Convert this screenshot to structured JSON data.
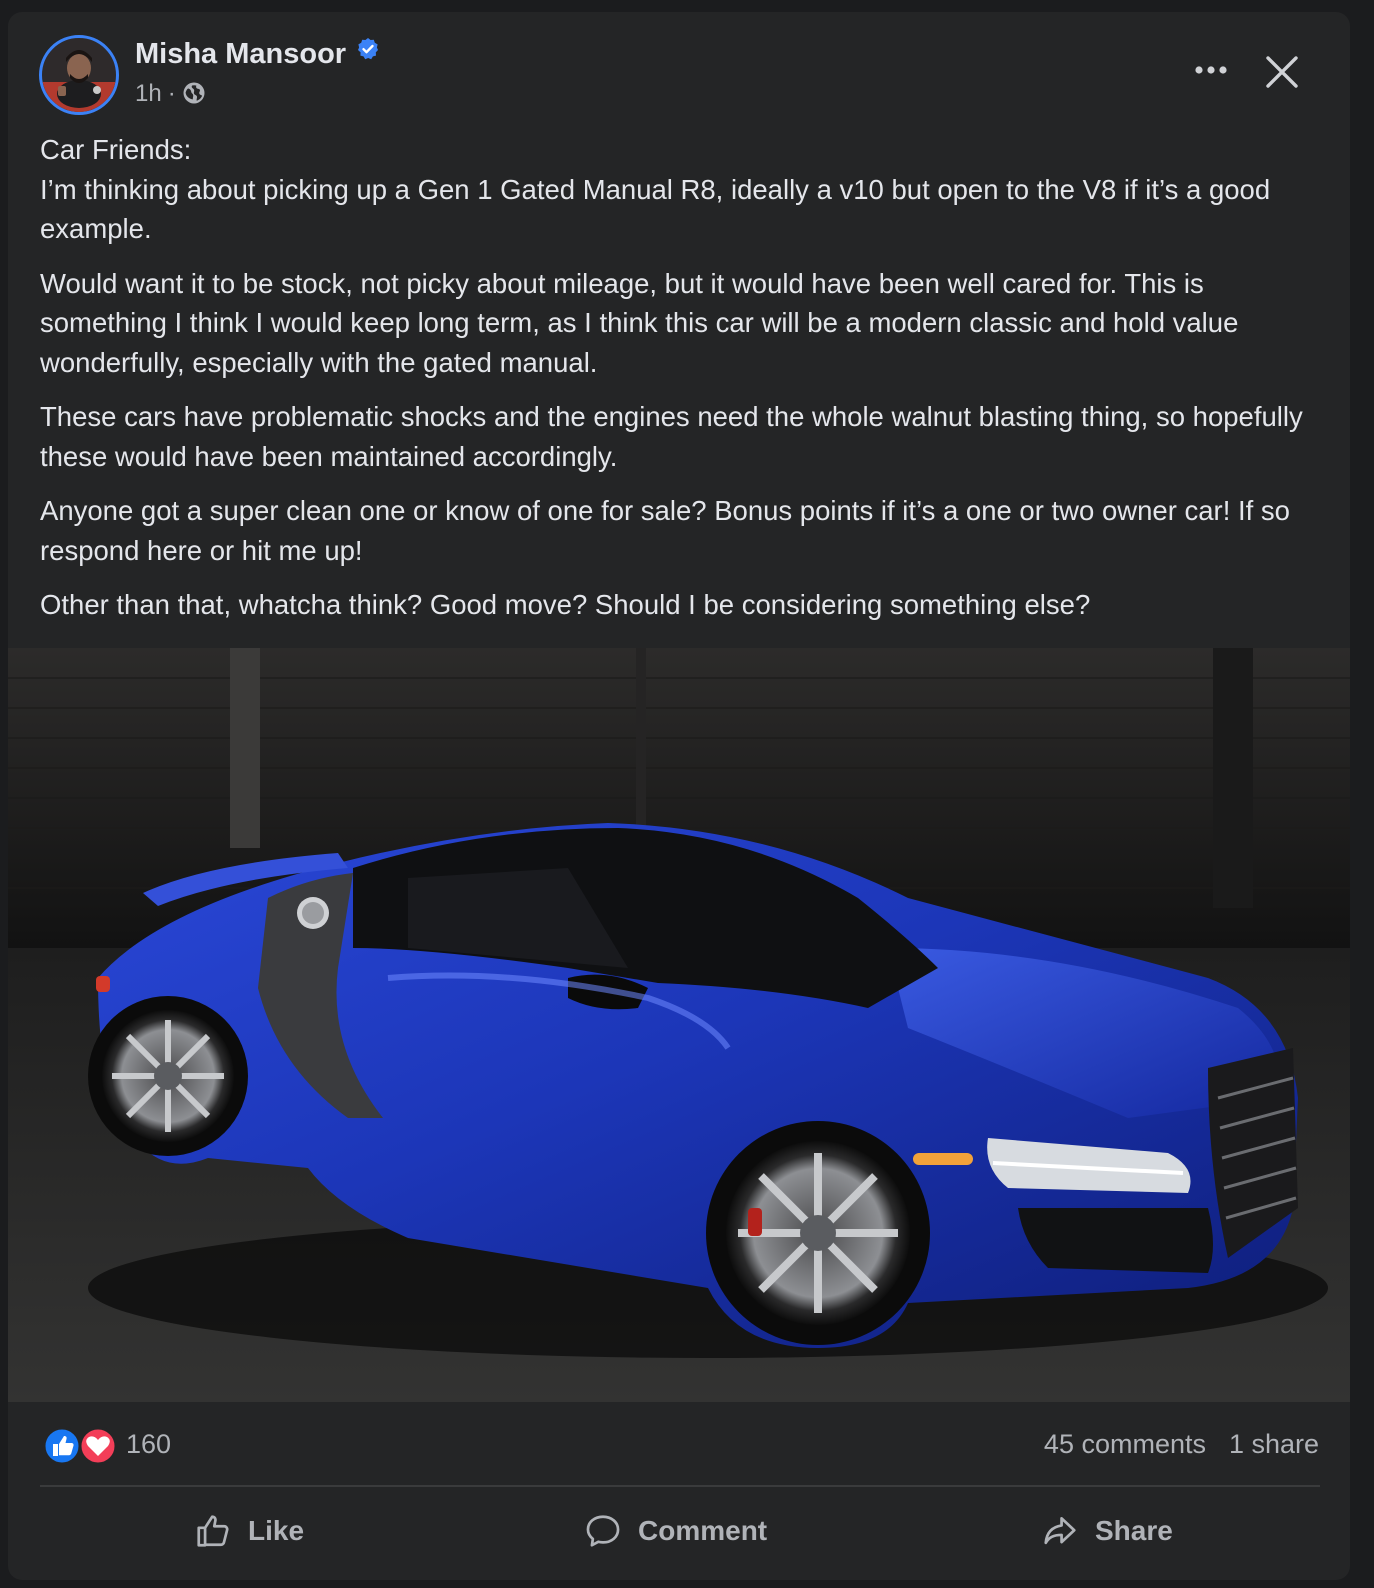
{
  "post": {
    "author": "Misha Mansoor",
    "time": "1h",
    "separator": "·",
    "paragraphs": [
      "Car Friends:\nI’m thinking about picking up a Gen 1 Gated Manual R8, ideally a v10 but open to the V8 if it’s a good example.",
      "Would want it to be stock, not picky about mileage, but it would have been well cared for.  This is something I think I would keep long term, as I think this car will be a modern classic and hold value wonderfully, especially with the gated manual.",
      "These cars have problematic shocks and the engines need the whole walnut blasting thing, so hopefully these would have been maintained accordingly.",
      "Anyone got a super clean one or know of one for sale? Bonus points if it’s a one or two owner car!  If so respond here or hit me up!",
      "Other than that, whatcha think? Good move? Should I be considering something else?"
    ],
    "reactions_count": "160",
    "comments_count": "45 comments",
    "shares_count": "1 share"
  },
  "actions": {
    "like": "Like",
    "comment": "Comment",
    "share": "Share"
  },
  "icons": {
    "verified": "verified-badge-icon",
    "privacy": "globe-icon",
    "more": "more-options-icon",
    "close": "close-icon",
    "like_reaction": "like-reaction-icon",
    "love_reaction": "love-reaction-icon"
  },
  "colors": {
    "background": "#242526",
    "text": "#e4e6eb",
    "secondary_text": "#b0b3b8",
    "accent_blue": "#1877f2",
    "love_red": "#f33e58",
    "car_blue": "#1f3fc4"
  }
}
